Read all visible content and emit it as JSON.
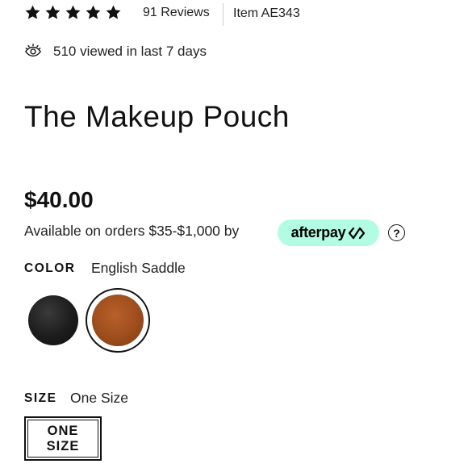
{
  "rating": {
    "stars": 5,
    "reviews_label": "91 Reviews"
  },
  "item_number": "Item AE343",
  "views": {
    "icon": "eye-icon",
    "text": "510 viewed in last 7 days"
  },
  "product": {
    "title": "The Makeup Pouch",
    "price": "$40.00"
  },
  "afterpay": {
    "text": "Available on orders $35-$1,000 by",
    "brand": "afterpay",
    "badge_color": "#b2fce4",
    "help_glyph": "?"
  },
  "color": {
    "label": "COLOR",
    "selected": "English Saddle",
    "swatches": [
      {
        "name": "black",
        "hex": "#1c1c1c"
      },
      {
        "name": "english-saddle",
        "hex": "#a04f1e",
        "selected": true
      }
    ]
  },
  "size": {
    "label": "SIZE",
    "selected": "One Size",
    "option_line1": "ONE",
    "option_line2": "SIZE"
  }
}
